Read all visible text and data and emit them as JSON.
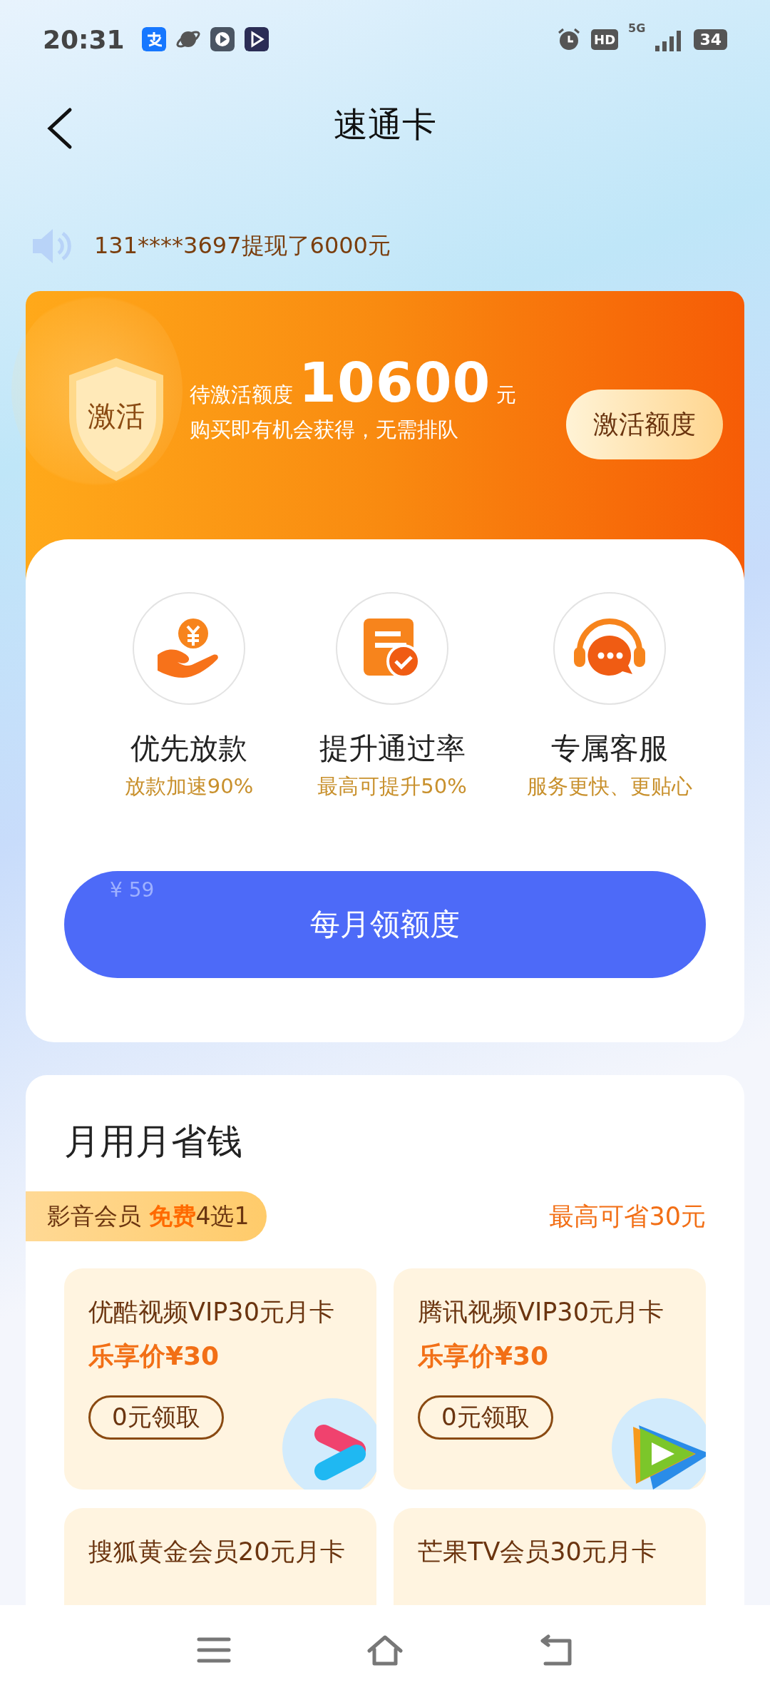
{
  "status_bar": {
    "time": "20:31",
    "hd": "HD",
    "network": "5G",
    "battery": "34"
  },
  "header": {
    "title": "速通卡"
  },
  "notice": {
    "text": "131****3697提现了6000元"
  },
  "activation": {
    "badge": "激活",
    "label": "待激活额度",
    "amount": "10600",
    "unit": "元",
    "subtitle": "购买即有机会获得，无需排队",
    "button": "激活额度"
  },
  "benefits": [
    {
      "kind": "coin-hand",
      "title": "优先放款",
      "subtitle": "放款加速90%"
    },
    {
      "kind": "document-check",
      "title": "提升通过率",
      "subtitle": "最高可提升50%"
    },
    {
      "kind": "headset-chat",
      "title": "专属客服",
      "subtitle": "服务更快、更贴心"
    }
  ],
  "main_button": {
    "price": "¥ 59",
    "label": "每月领额度"
  },
  "savings": {
    "title": "月用月省钱",
    "ribbon": "影音会员 **免费**4选1",
    "max_saving": "最高可省30元",
    "cards": [
      {
        "title": "优酷视频VIP30元月卡",
        "price": "乐享价¥30",
        "button": "0元领取"
      },
      {
        "title": "腾讯视频VIP30元月卡",
        "price": "乐享价¥30",
        "button": "0元领取"
      },
      {
        "title": "搜狐黄金会员20元月卡"
      },
      {
        "title": "芒果TV会员30元月卡"
      }
    ]
  }
}
